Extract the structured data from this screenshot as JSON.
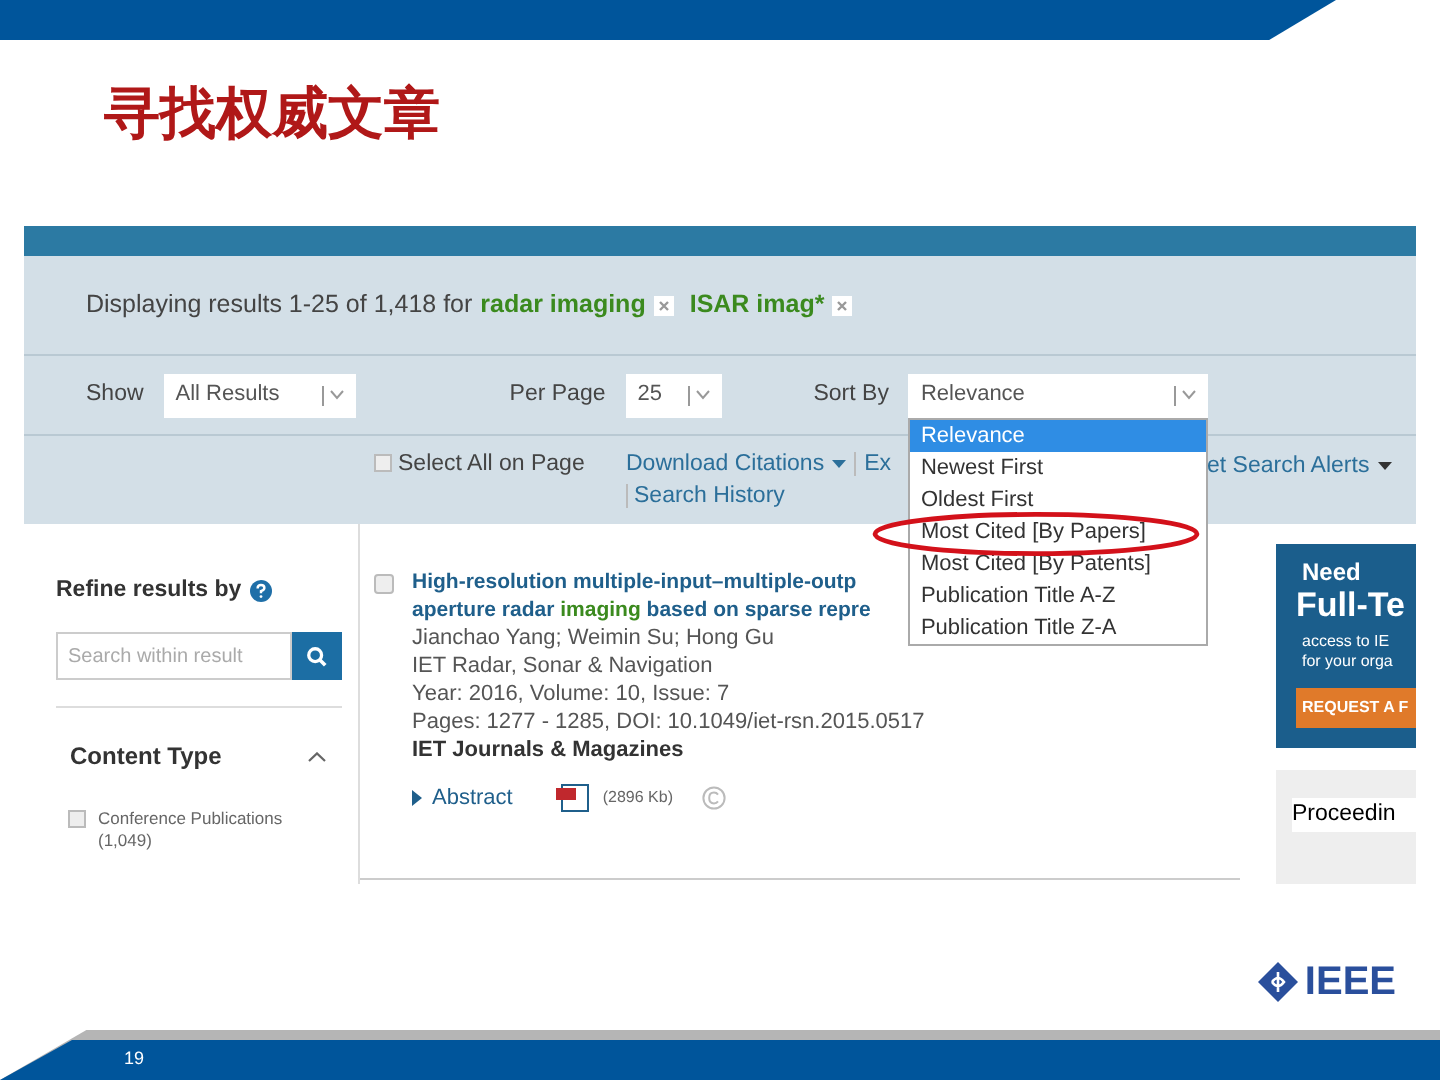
{
  "slide": {
    "title": "寻找权威文章",
    "page_number": "19",
    "logo_text": "IEEE"
  },
  "screenshot": {
    "query": {
      "prefix": "Displaying results 1-25 of 1,418 for",
      "terms": [
        "radar imaging",
        "ISAR imag*"
      ]
    },
    "filters": [
      {
        "label": "Show",
        "value": "All Results"
      },
      {
        "label": "Per Page",
        "value": "25"
      },
      {
        "label": "Sort By",
        "value": "Relevance"
      }
    ],
    "sort_options": [
      {
        "label": "Relevance",
        "selected": true
      },
      {
        "label": "Newest First",
        "selected": false
      },
      {
        "label": "Oldest First",
        "selected": false
      },
      {
        "label": "Most Cited [By Papers]",
        "selected": false
      },
      {
        "label": "Most Cited [By Patents]",
        "selected": false
      },
      {
        "label": "Publication Title A-Z",
        "selected": false
      },
      {
        "label": "Publication Title Z-A",
        "selected": false
      }
    ],
    "toolbar": {
      "select_all": {
        "label": "Select All on Page",
        "checked": false
      },
      "links": [
        "Download Citations",
        "Ex",
        "et Search Alerts"
      ],
      "search_history": "Search History"
    },
    "sidebar": {
      "heading": "Refine results by",
      "search_placeholder": "Search within result",
      "section": "Content Type",
      "expanded": true,
      "items": [
        {
          "label": "Conference Publications",
          "count": "(1,049)",
          "checked": false
        }
      ]
    },
    "result": {
      "checked": false,
      "title_lines": [
        [
          {
            "text": "High-resolution multiple-input–multiple-outp",
            "highlight": false
          }
        ],
        [
          {
            "text": "aperture radar ",
            "highlight": false
          },
          {
            "text": "imaging",
            "highlight": true
          },
          {
            "text": " based on sparse repre",
            "highlight": false
          }
        ]
      ],
      "authors": "Jianchao Yang; Weimin Su; Hong Gu",
      "publication": "IET Radar, Sonar & Navigation",
      "details": [
        "Year: 2016, Volume: 10, Issue: 7",
        "Pages: 1277 - 1285, DOI: 10.1049/iet-rsn.2015.0517"
      ],
      "publisher": "IET Journals & Magazines",
      "abstract": "Abstract",
      "file_size": "(2896 Kb)"
    },
    "ads": {
      "line_1": "Need",
      "line_2": "Full-Te",
      "line_3": "access to IE",
      "line_4": "for your orga",
      "button": "REQUEST A F",
      "second": "Proceedin"
    }
  }
}
